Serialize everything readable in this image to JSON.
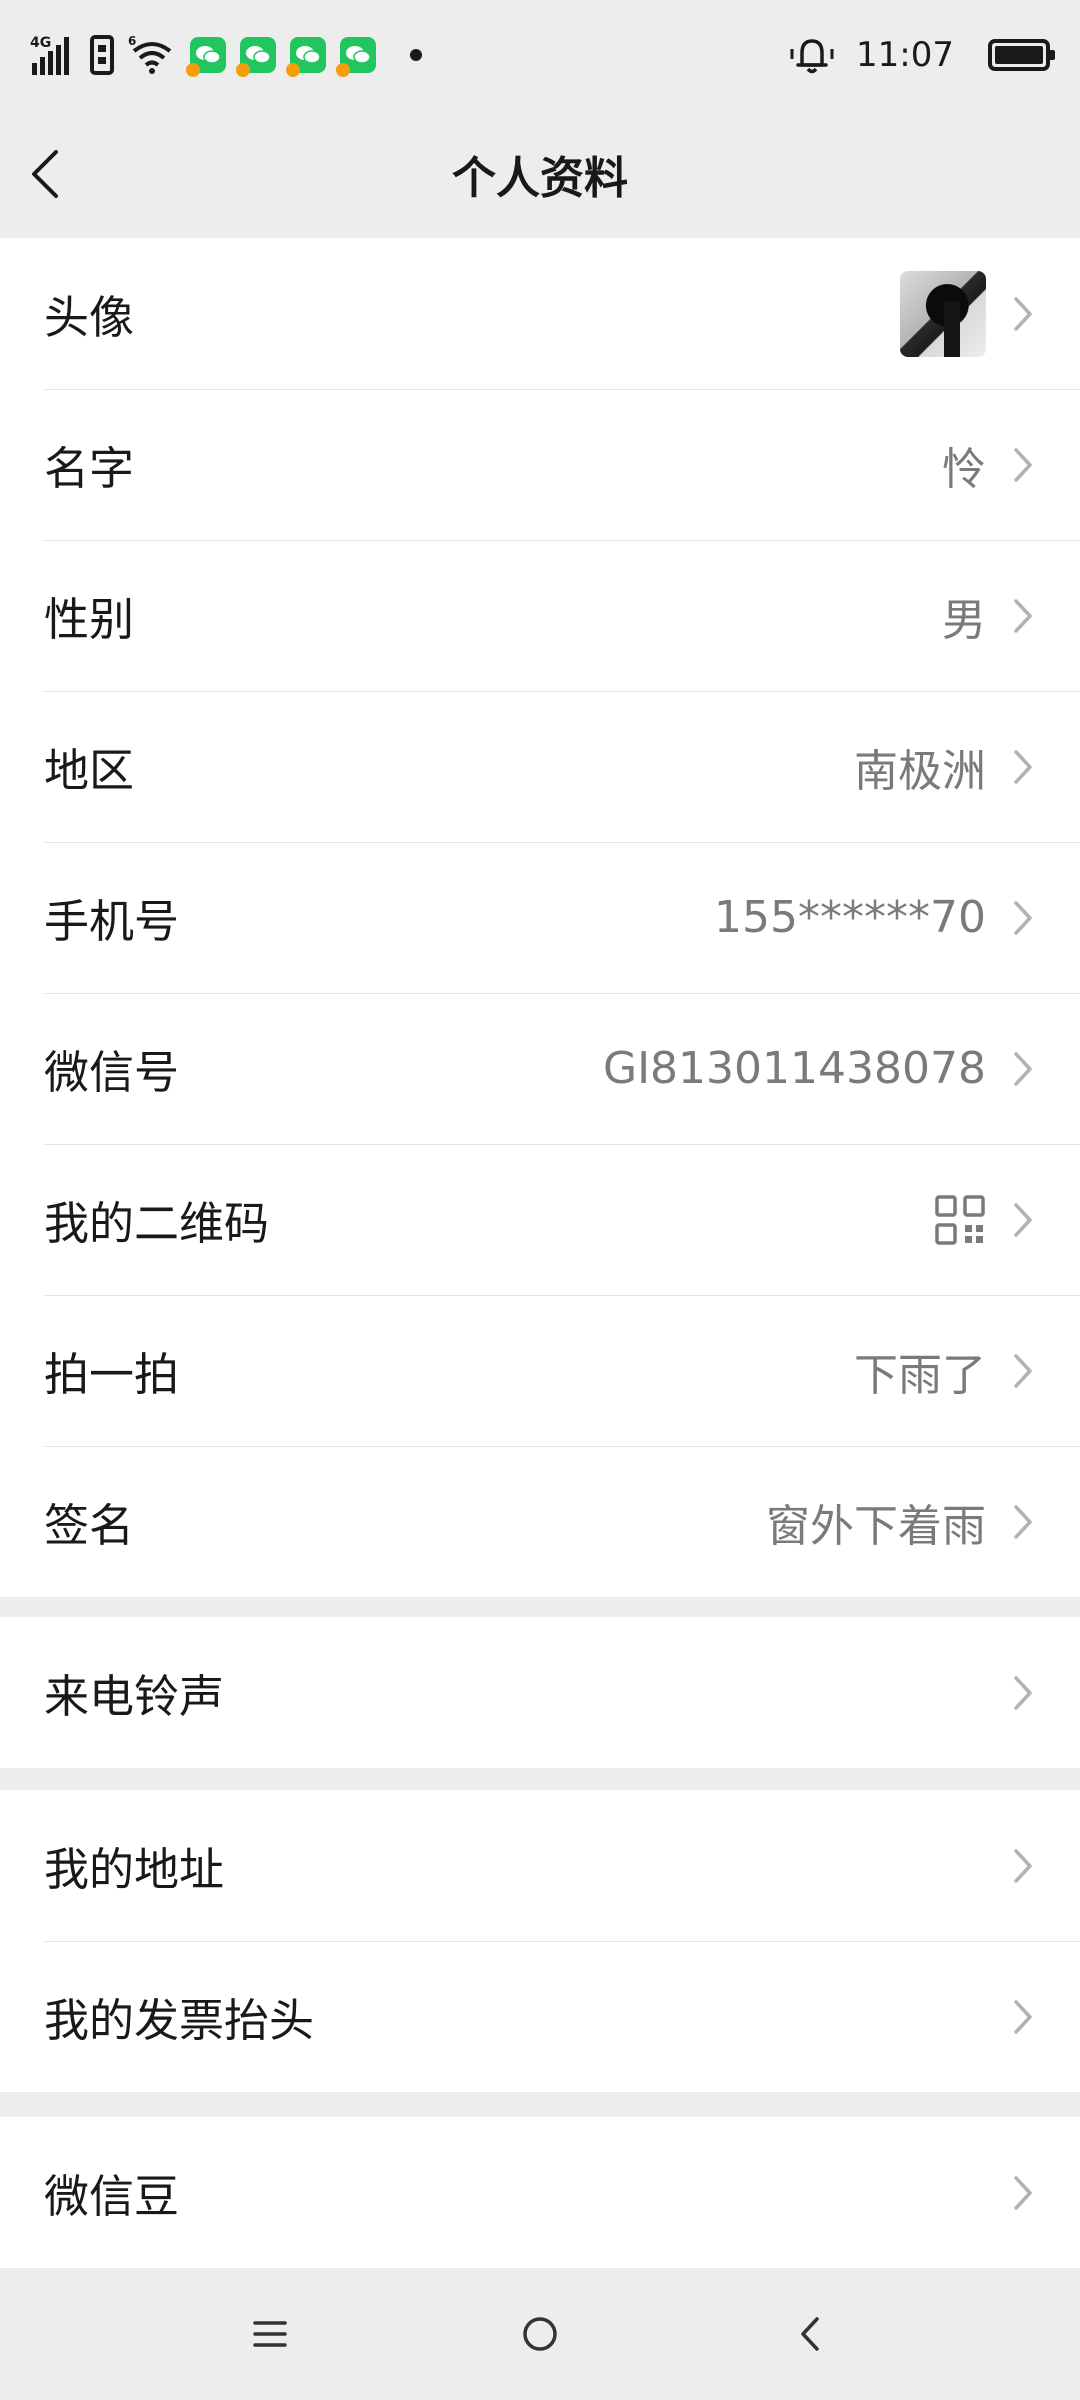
{
  "status_bar": {
    "network_label": "4G",
    "wifi_label": "6",
    "time": "11:07"
  },
  "header": {
    "title": "个人资料"
  },
  "profile": {
    "avatar_label": "头像",
    "name_label": "名字",
    "name_value": "怜",
    "gender_label": "性别",
    "gender_value": "男",
    "region_label": "地区",
    "region_value": "南极洲",
    "phone_label": "手机号",
    "phone_value": "155******70",
    "wechat_id_label": "微信号",
    "wechat_id_value": "GI813011438078",
    "qr_code_label": "我的二维码",
    "pat_label": "拍一拍",
    "pat_value": "下雨了",
    "signature_label": "签名",
    "signature_value": "窗外下着雨"
  },
  "ringtone": {
    "label": "来电铃声"
  },
  "address": {
    "my_address_label": "我的地址",
    "invoice_label": "我的发票抬头"
  },
  "beans": {
    "label": "微信豆"
  },
  "colors": {
    "background": "#ededed",
    "card": "#ffffff",
    "text_primary": "#191919",
    "text_secondary": "#7a7a7a",
    "chevron": "#b2b2b2",
    "wechat_green": "#22c55e"
  },
  "icons": {
    "back": "back-chevron-icon",
    "row_arrow": "chevron-right-icon",
    "qr": "qr-code-icon",
    "nav_menu": "menu-icon",
    "nav_home": "home-circle-icon",
    "nav_back": "nav-back-icon"
  }
}
